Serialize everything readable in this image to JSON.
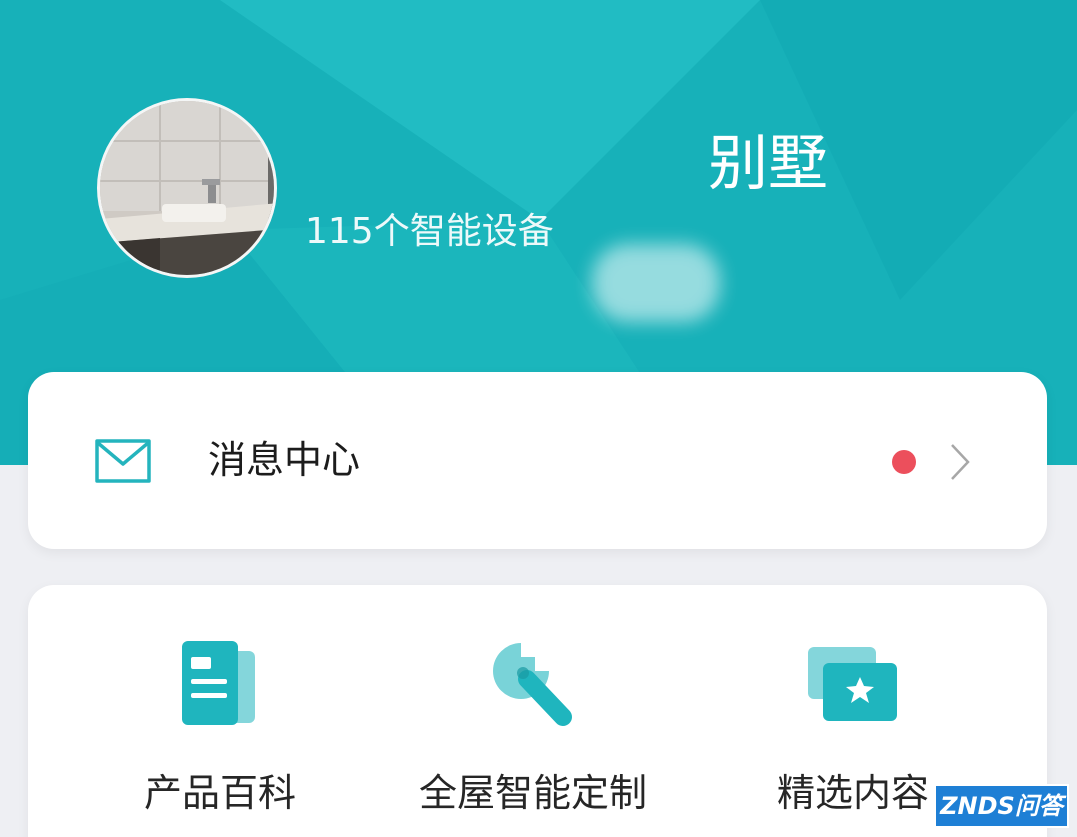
{
  "home": {
    "name_suffix": "别墅",
    "device_count": "115个智能设备"
  },
  "message_center": {
    "label": "消息中心",
    "unread_indicator": true
  },
  "features": [
    {
      "label": "产品百科",
      "icon": "document-icon"
    },
    {
      "label": "全屋智能定制",
      "icon": "wrench-icon"
    },
    {
      "label": "精选内容",
      "icon": "star-folder-icon"
    }
  ],
  "watermark": {
    "text": "ZNDS问答"
  },
  "colors": {
    "header": "#17b1b9",
    "accent": "#1fb5be",
    "badge": "#ec4f5c",
    "background": "#eeeff3",
    "watermark": "#1e7fd5"
  }
}
